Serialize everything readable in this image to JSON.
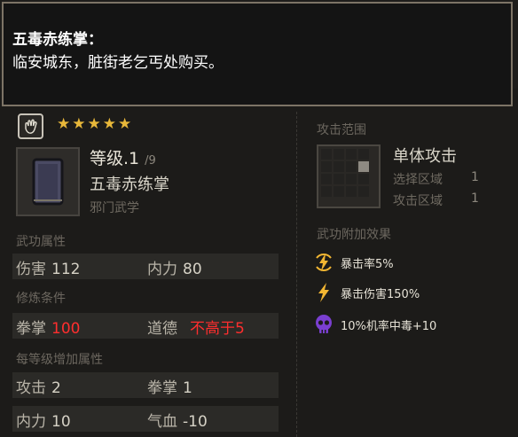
{
  "tooltip": {
    "title": "五毒赤练掌：",
    "body": "临安城东，脏街老乞丐处购买。"
  },
  "skill": {
    "badge_icon": "palm-icon",
    "stars": "★★★★★",
    "star_count": 5,
    "level": "等级.1",
    "level_max": "/9",
    "name": "五毒赤练掌",
    "school": "邪门武学"
  },
  "attributes": {
    "label": "武功属性",
    "damage_label": "伤害",
    "damage_value": "112",
    "neili_label": "内力",
    "neili_value": "80"
  },
  "requirements": {
    "label": "修炼条件",
    "quanzhang_label": "拳掌",
    "quanzhang_value": "100",
    "morality_label": "道德",
    "morality_value": "不高于5"
  },
  "per_level": {
    "label": "每等级增加属性",
    "attack_label": "攻击",
    "attack_value": "2",
    "quanzhang_label": "拳掌",
    "quanzhang_value": "1",
    "neili_label": "内力",
    "neili_value": "10",
    "qixue_label": "气血",
    "qixue_value": "-10"
  },
  "range": {
    "label": "攻击范围",
    "type": "单体攻击",
    "select_label": "选择区域",
    "select_value": "1",
    "attack_label": "攻击区域",
    "attack_value": "1"
  },
  "effects": {
    "label": "武功附加效果",
    "items": [
      {
        "icon": "lightning-circle-icon",
        "text": "暴击率5%"
      },
      {
        "icon": "lightning-icon",
        "text": "暴击伤害150%"
      },
      {
        "icon": "skull-icon",
        "text": "10%机率中毒+10"
      }
    ]
  },
  "colors": {
    "star": "#e8b83a",
    "warning_red": "#ff2e2e",
    "lightning": "#f2b632",
    "poison": "#7a3fd0"
  }
}
